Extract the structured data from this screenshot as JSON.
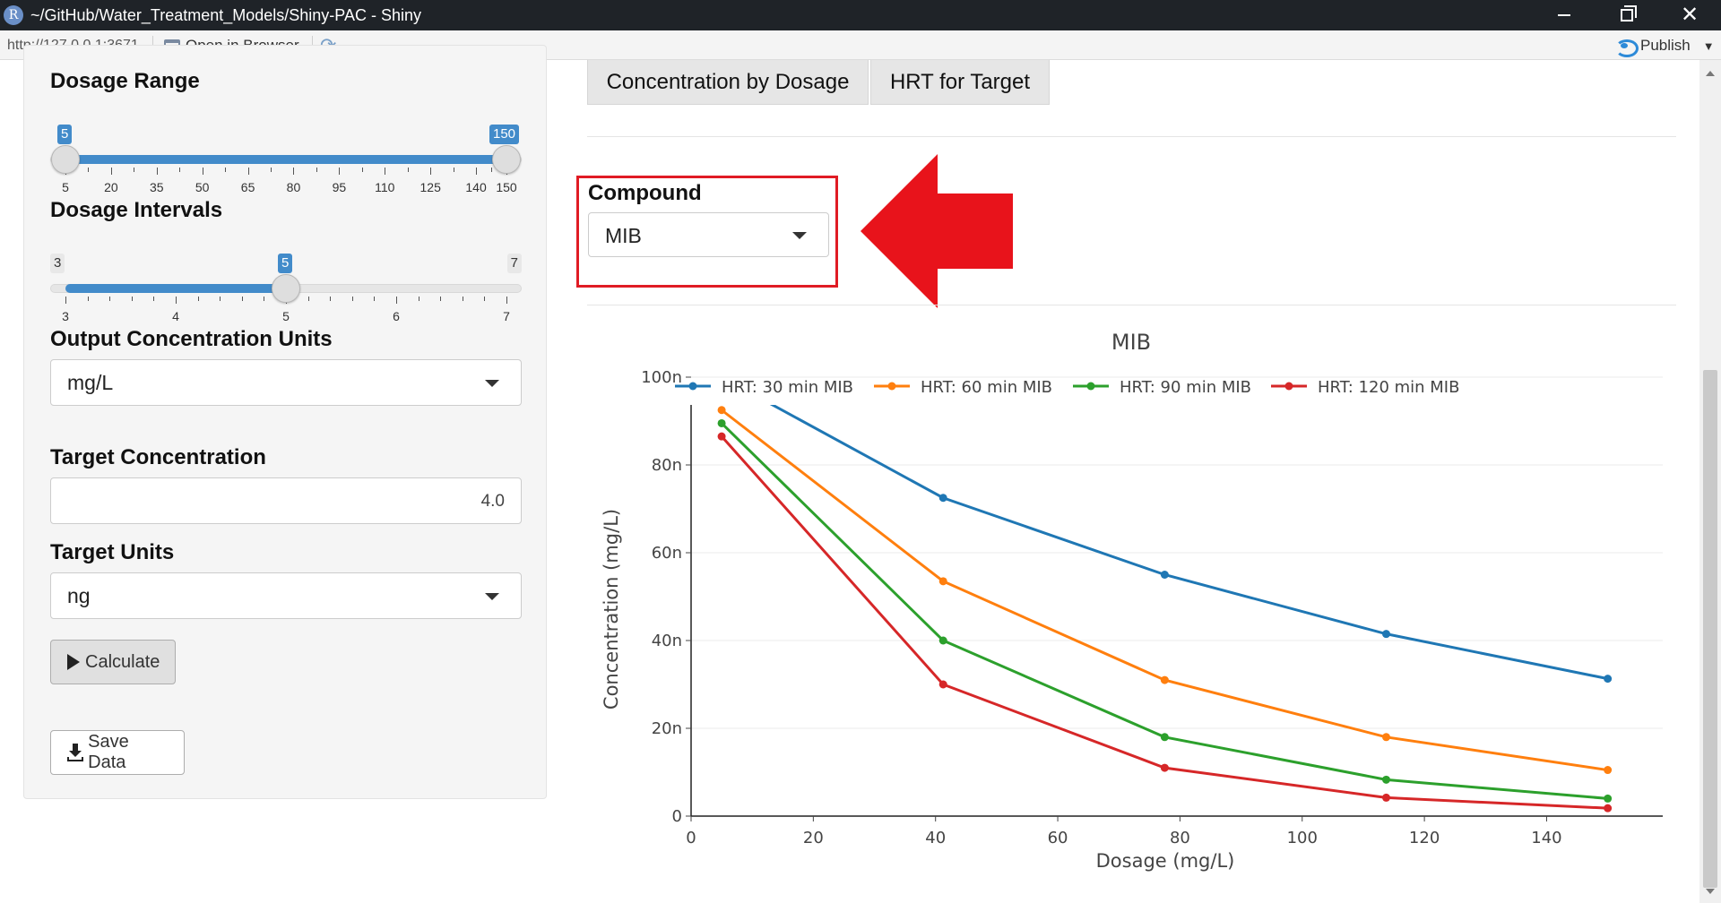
{
  "window": {
    "title": "~/GitHub/Water_Treatment_Models/Shiny-PAC - Shiny",
    "url": "http://127.0.0.1:3671",
    "open_in_browser": "Open in Browser",
    "publish": "Publish"
  },
  "sidebar": {
    "dosage_range": {
      "label": "Dosage Range",
      "min": 5,
      "max": 150,
      "selected_low": "5",
      "selected_high": "150",
      "ticks": [
        "5",
        "20",
        "35",
        "50",
        "65",
        "80",
        "95",
        "110",
        "125",
        "140",
        "150"
      ]
    },
    "dosage_intervals": {
      "label": "Dosage Intervals",
      "min_label": "3",
      "max_label": "7",
      "value_label": "5",
      "value": 5,
      "min": 3,
      "max": 7,
      "ticks": [
        "3",
        "4",
        "5",
        "6",
        "7"
      ]
    },
    "output_units": {
      "label": "Output Concentration Units",
      "value": "mg/L"
    },
    "target_concentration": {
      "label": "Target Concentration",
      "value": "4.0"
    },
    "target_units": {
      "label": "Target Units",
      "value": "ng"
    },
    "calculate_label": "Calculate",
    "save_label": "Save Data"
  },
  "main": {
    "tabs": [
      {
        "label": "Concentration by Dosage"
      },
      {
        "label": "HRT for Target"
      }
    ],
    "compound": {
      "label": "Compound",
      "value": "MIB"
    },
    "colors": {
      "highlight": "#e01b24",
      "arrow": "#e8131b"
    }
  },
  "chart_data": {
    "type": "line",
    "title": "MIB",
    "xlabel": "Dosage (mg/L)",
    "ylabel": "Concentration (mg/L)",
    "xlim": [
      0,
      159
    ],
    "ylim": [
      0,
      100
    ],
    "xticks": [
      0,
      20,
      40,
      60,
      80,
      100,
      120,
      140
    ],
    "yticks": [
      0,
      20,
      40,
      60,
      80,
      100
    ],
    "ytick_labels": [
      "0",
      "20n",
      "40n",
      "60n",
      "80n",
      "100n"
    ],
    "x": [
      5,
      41.25,
      77.5,
      113.75,
      150
    ],
    "legend_position": "top",
    "grid": true,
    "series": [
      {
        "name": "HRT: 30 min MIB",
        "color": "#1f77b4",
        "values": [
          100,
          72.5,
          55,
          41.5,
          31.3
        ]
      },
      {
        "name": "HRT: 60 min MIB",
        "color": "#ff7f0e",
        "values": [
          92.5,
          53.5,
          31,
          18,
          10.5
        ]
      },
      {
        "name": "HRT: 90 min MIB",
        "color": "#2ca02c",
        "values": [
          89.5,
          40,
          18,
          8.3,
          4
        ]
      },
      {
        "name": "HRT: 120 min MIB",
        "color": "#d62728",
        "values": [
          86.5,
          30,
          11,
          4.2,
          1.8
        ]
      }
    ]
  }
}
